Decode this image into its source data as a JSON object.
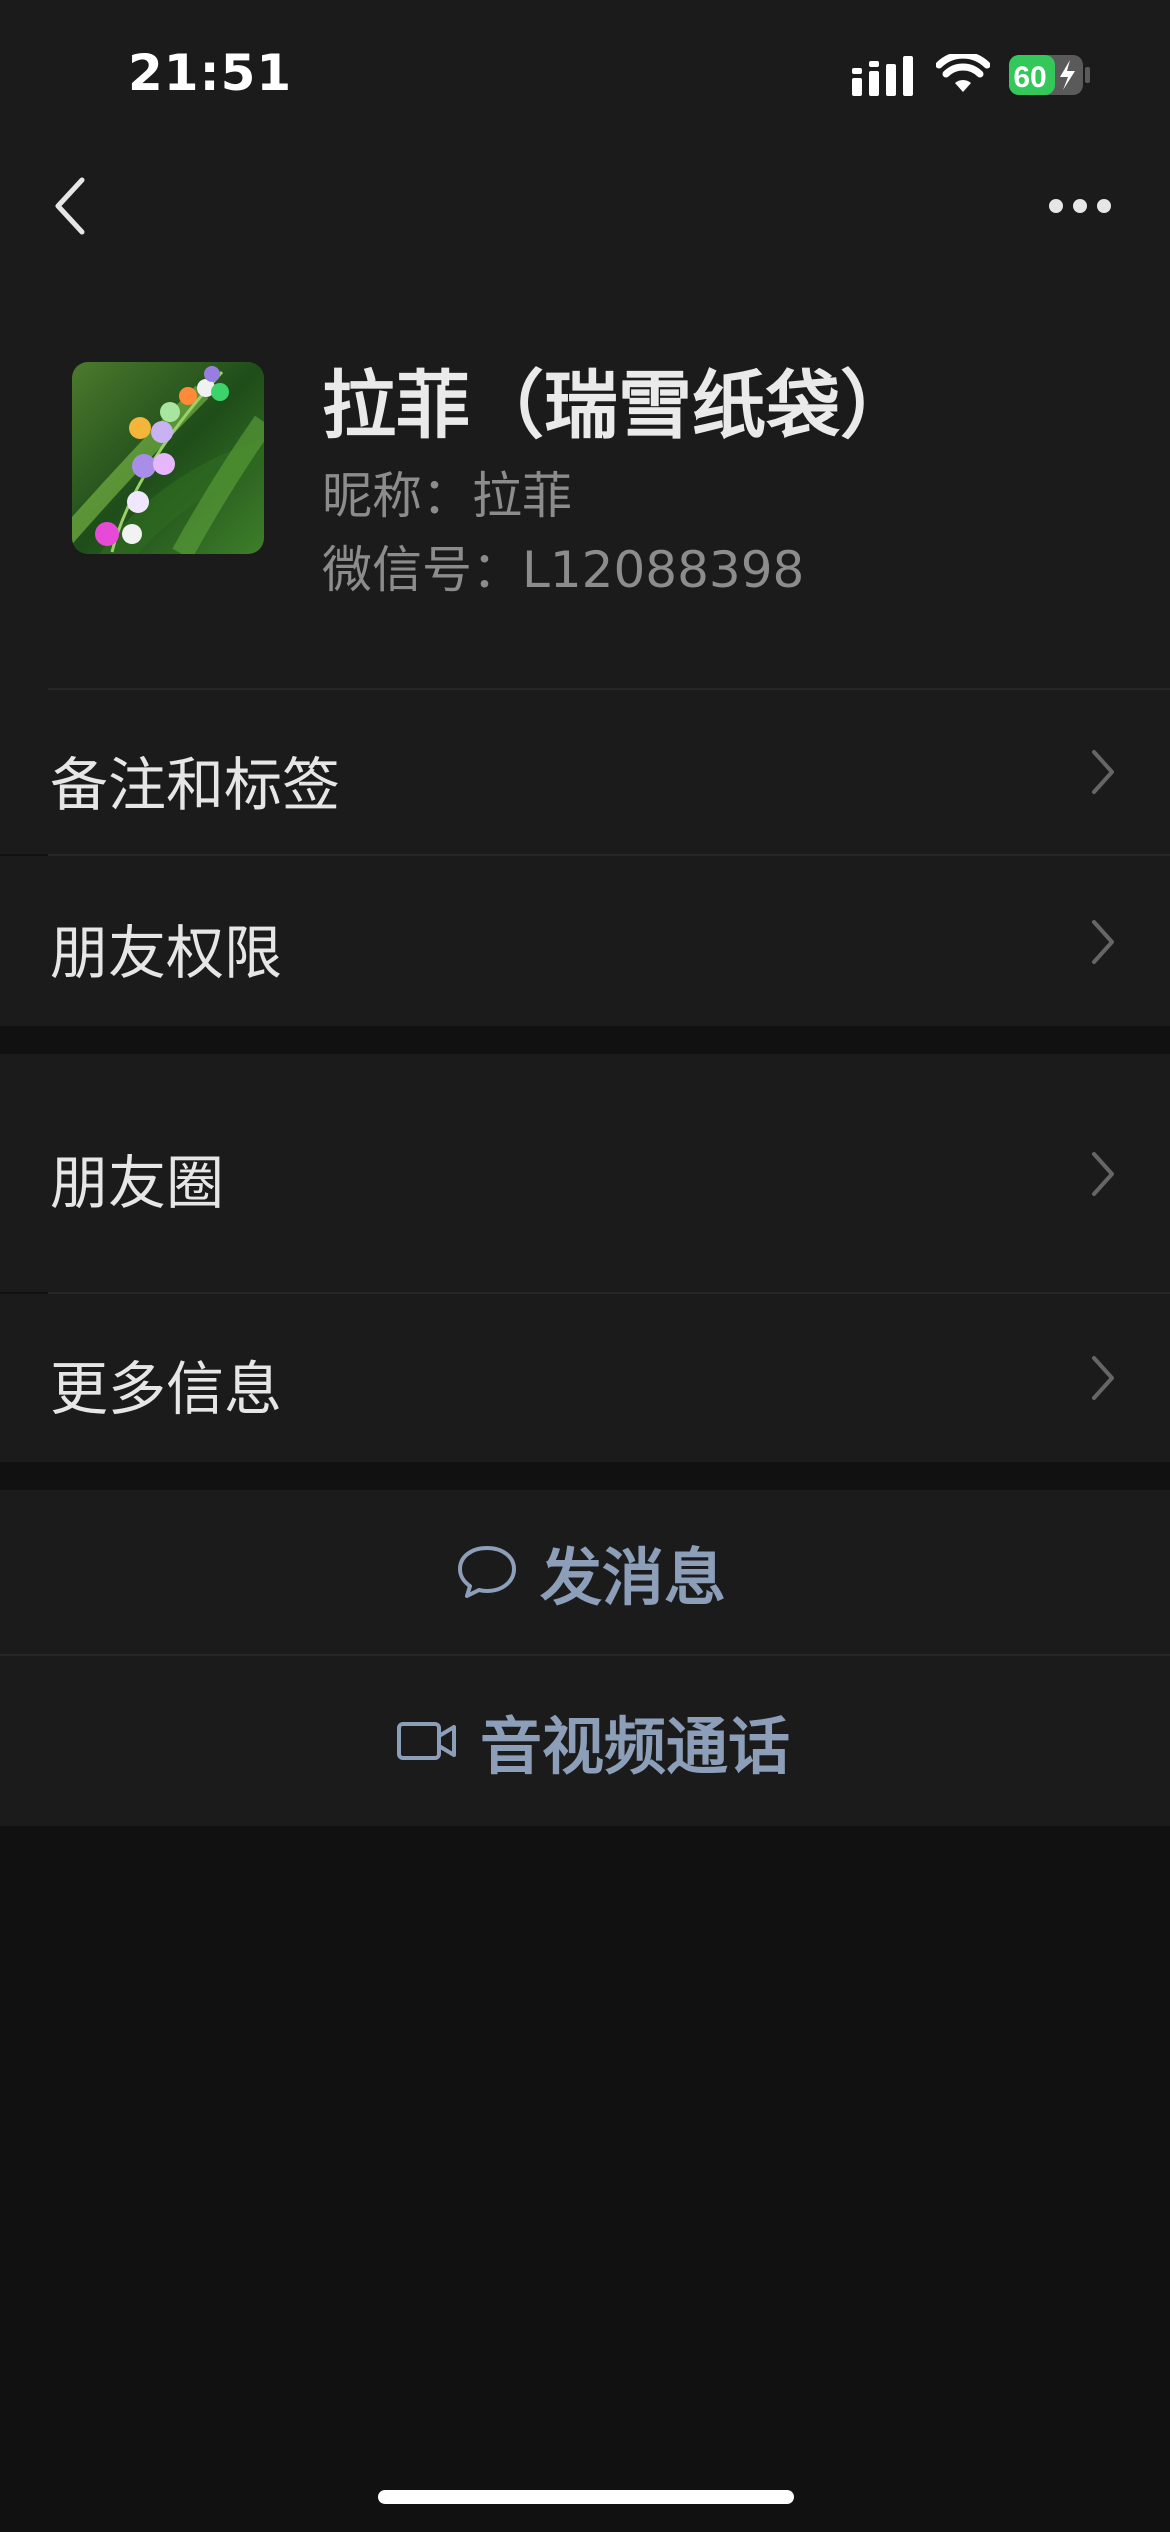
{
  "status_bar": {
    "time": "21:51",
    "battery_percent": "60",
    "battery_level": 0.6,
    "battery_color": "#34c759",
    "charging": true
  },
  "nav": {
    "back_icon": "chevron-left-icon",
    "more_icon": "ellipsis-icon"
  },
  "profile": {
    "display_name": "拉菲（瑞雪纸袋）",
    "nickname_label": "昵称",
    "nickname": "拉菲",
    "nickname_line": "昵称：拉菲",
    "wechat_id_label": "微信号",
    "wechat_id": "L12088398",
    "wechat_id_line": "微信号：L12088398",
    "avatar_icon": "lily-of-the-valley-avatar"
  },
  "menu": {
    "remarks_tags": "备注和标签",
    "friend_permissions": "朋友权限",
    "moments": "朋友圈",
    "more_info": "更多信息"
  },
  "actions": {
    "send_message": "发消息",
    "send_message_icon": "chat-bubble-icon",
    "video_call": "音视频通话",
    "video_call_icon": "video-camera-icon",
    "accent_color": "#8c9eb8"
  },
  "theme": {
    "background": "#111111",
    "surface": "#1b1b1b",
    "text_primary": "#e6e6e6",
    "text_secondary": "#8c8c8c"
  }
}
